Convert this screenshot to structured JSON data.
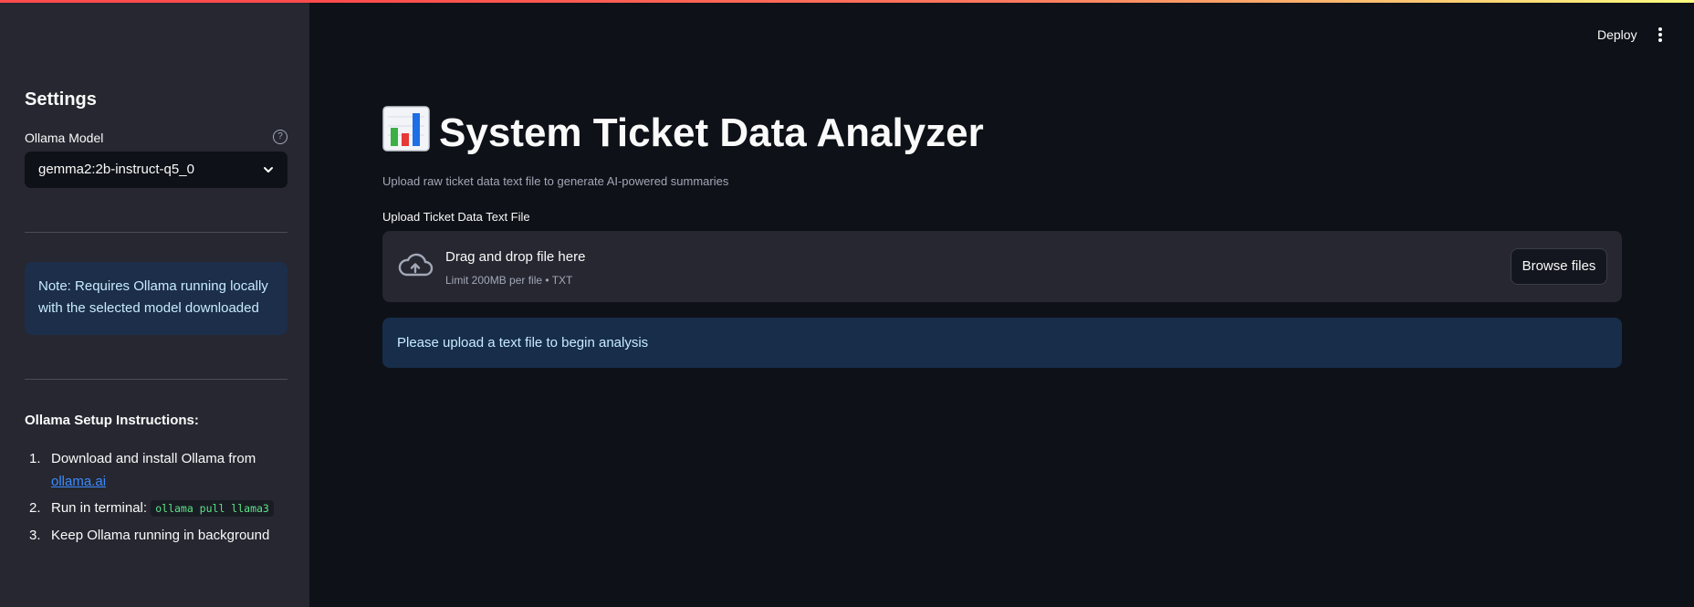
{
  "header": {
    "deploy_label": "Deploy",
    "menu_icon": "kebab-menu-icon"
  },
  "sidebar": {
    "title": "Settings",
    "model_label": "Ollama Model",
    "model_help_icon": "help-circle-icon",
    "model_value": "gemma2:2b-instruct-q5_0",
    "note": "Note: Requires Ollama running locally with the selected model downloaded",
    "setup_title": "Ollama Setup Instructions:",
    "steps": [
      {
        "num": "1.",
        "text": "Download and install Ollama from ",
        "link": "ollama.ai"
      },
      {
        "num": "2.",
        "text": "Run in terminal: ",
        "code": "ollama pull llama3"
      },
      {
        "num": "3.",
        "text": "Keep Ollama running in background"
      }
    ]
  },
  "main": {
    "title": "System Ticket Data Analyzer",
    "title_icon": "bar-chart-emoji-icon",
    "subtitle": "Upload raw ticket data text file to generate AI-powered summaries",
    "upload_label": "Upload Ticket Data Text File",
    "dropzone": {
      "icon": "cloud-upload-icon",
      "main_text": "Drag and drop file here",
      "limit_text": "Limit 200MB per file • TXT",
      "button_label": "Browse files"
    },
    "info_message": "Please upload a text file to begin analysis"
  },
  "colors": {
    "background": "#0e1117",
    "sidebar": "#262730",
    "info_bg": "#172d4a",
    "info_text": "#c7ebff",
    "link": "#3a8bff",
    "code": "#5ce488"
  }
}
